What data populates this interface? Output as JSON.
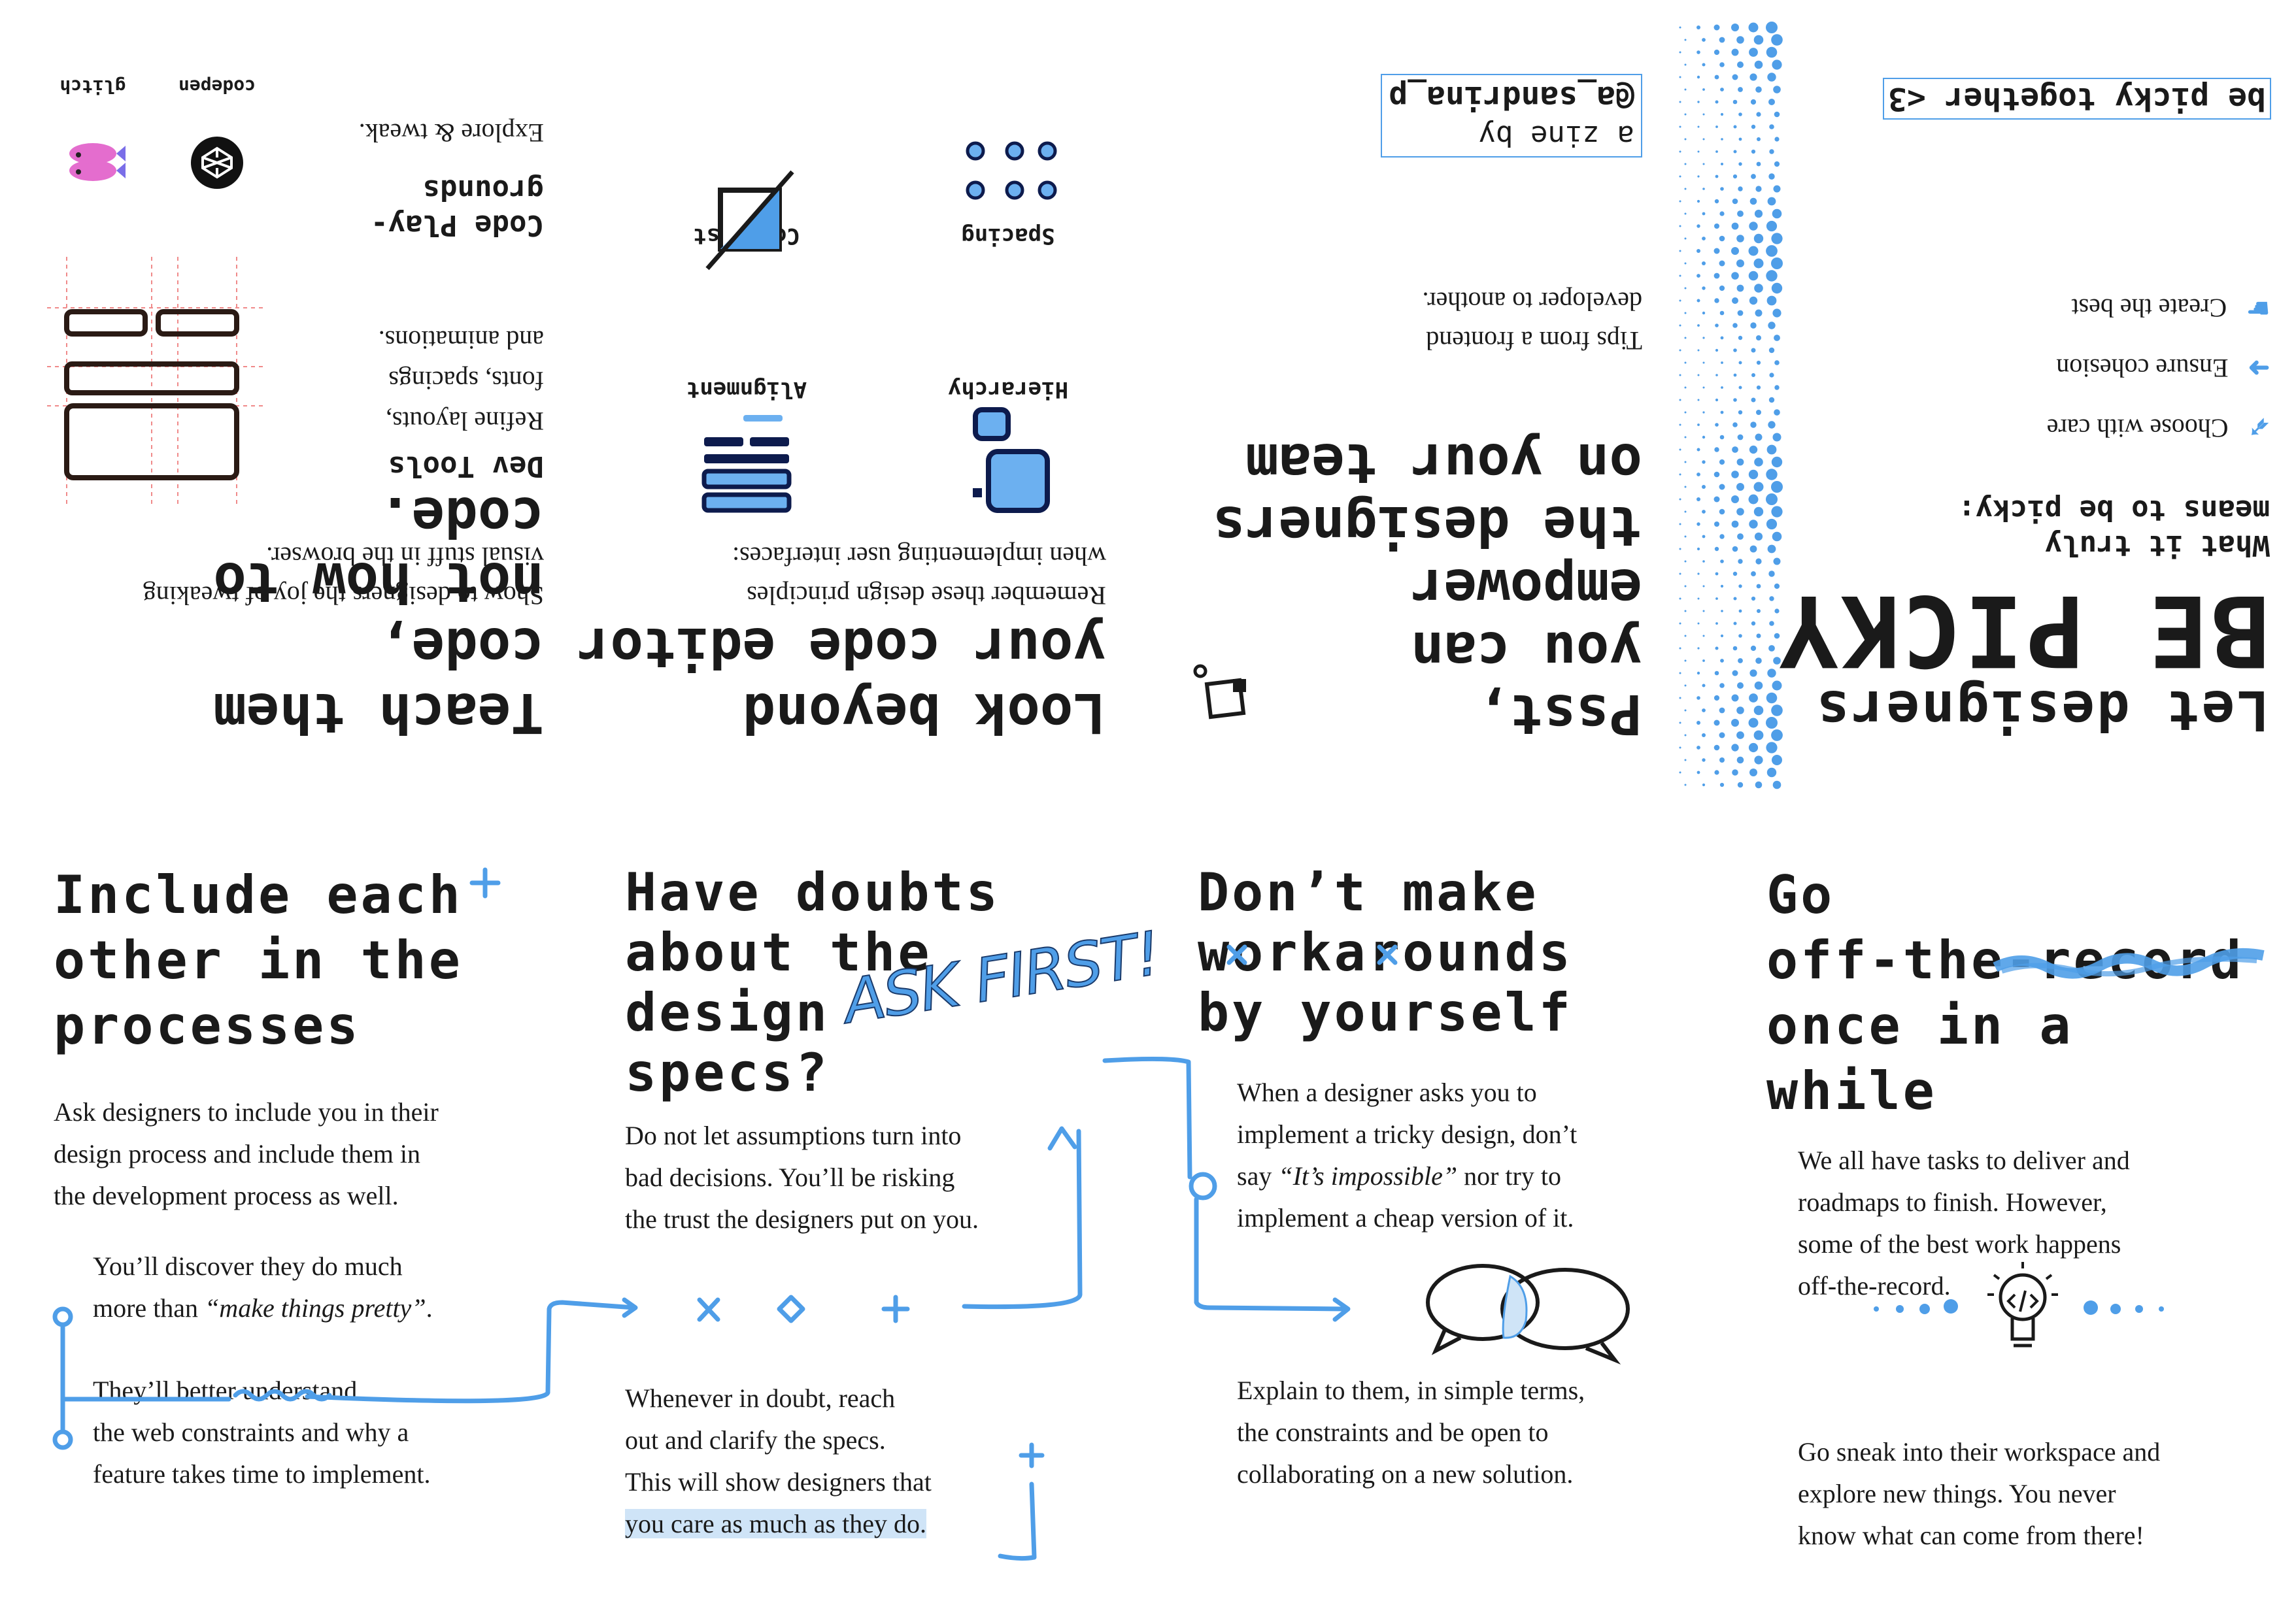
{
  "colors": {
    "accent": "#4f9ee8",
    "ink": "#1a1a1a",
    "highlight": "#cfe4f7"
  },
  "cover": {
    "tagline": "be picky together <3",
    "title_line1": "Let designers",
    "title_line2": "BE PICKY",
    "subtitle_line1": "What it truly",
    "subtitle_line2": "means to be picky:",
    "items": [
      "Choose with care",
      "Ensure cohesion",
      "Create the best"
    ]
  },
  "intro": {
    "credit_line1": "a zine by",
    "credit_line2": "@a_sandrina_p",
    "heading_lines": [
      "Psst,",
      "you can",
      "empower",
      "the designers",
      "on your team"
    ],
    "text_line1": "Tips from a frontend",
    "text_line2": "developer to another."
  },
  "editor": {
    "heading_lines": [
      "Look beyond",
      "your code editor"
    ],
    "text_line1": "Remember these design principles",
    "text_line2": "when implementing user interfaces:",
    "principles": [
      "Hierarchy",
      "Alignment",
      "Spacing",
      "Contrast"
    ]
  },
  "teach": {
    "heading_lines": [
      "Teach them code,",
      "not how to code."
    ],
    "text_line1": "Show to designers the joy of tweaking",
    "text_line2": "visual stuff in the browser.",
    "devtools": {
      "title": "Dev Tools",
      "lines": [
        "Refine layouts,",
        "fonts, spacings",
        "and animations."
      ]
    },
    "playgrounds": {
      "title_line1": "Code Play-",
      "title_line2": "grounds",
      "text": "Explore & tweak."
    },
    "logos": [
      "codepen",
      "glitch"
    ]
  },
  "panels": [
    {
      "title_lines": [
        "Include each",
        "other in the",
        "processes"
      ],
      "para_lines": [
        "Ask designers to include you in their",
        "design process and include them in",
        "the development process as well."
      ],
      "bullet1_lines": [
        "You’ll discover they do much",
        "more than "
      ],
      "bullet1_italic": "“make things pretty”",
      "bullet1_end": ".",
      "bullet2_lines": [
        "They’ll better understand",
        "the web constraints and why a",
        "feature takes time to implement."
      ]
    },
    {
      "title_lines": [
        "Have doubts",
        "about the",
        "design",
        "specs?"
      ],
      "callout": "ASK FIRST!",
      "para_lines": [
        "Do not let assumptions turn into",
        "bad decisions. You’ll be risking",
        "the trust the designers put on you."
      ],
      "para2_lines": [
        "Whenever in doubt, reach",
        "out and clarify the specs.",
        "This will show designers that"
      ],
      "para2_highlight": "you care as much as they do."
    },
    {
      "title_lines": [
        "Don’t make",
        "workarounds",
        "by yourself"
      ],
      "para_line1": "When a designer asks you to",
      "para_line2": "implement a tricky design, don’t",
      "para_line3_pre": "say ",
      "para_line3_italic": "“It’s impossible”",
      "para_line3_post": " nor try to",
      "para_line4": "implement a cheap version of it.",
      "para2_lines": [
        "Explain to them, in simple terms,",
        "the constraints and be open to",
        "collaborating on a new solution."
      ]
    },
    {
      "title_line1": "Go",
      "title_line2": "off-the-record",
      "title_line3": "once in a while",
      "para_lines": [
        "We all have tasks to deliver and",
        "roadmaps to finish. However,",
        "some of the best work happens",
        "off-the-record."
      ],
      "para2_lines": [
        "Go sneak into their workspace and",
        "explore new things. You never",
        "know what can come from there!"
      ]
    }
  ]
}
